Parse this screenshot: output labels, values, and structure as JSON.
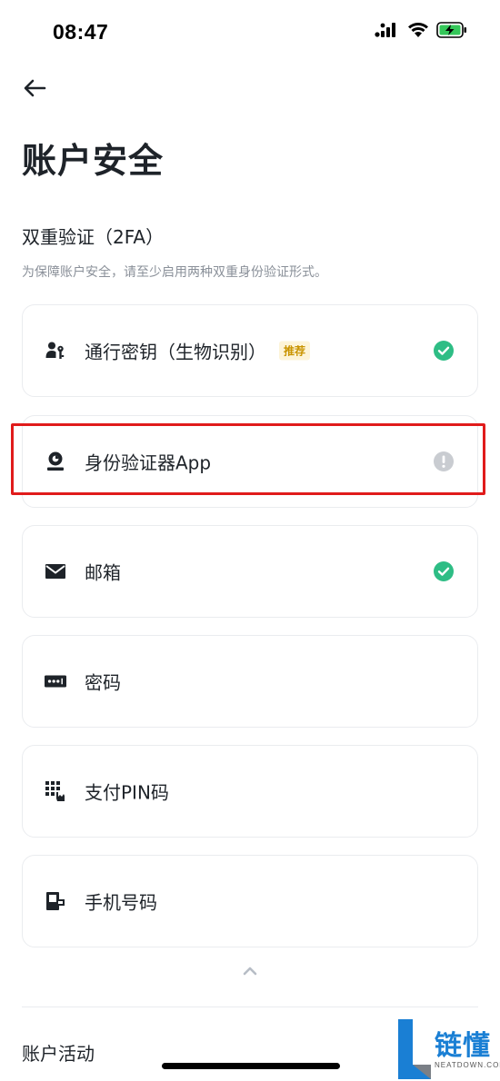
{
  "status_bar": {
    "time": "08:47"
  },
  "header": {
    "title": "账户安全"
  },
  "twofa": {
    "title": "双重验证（2FA）",
    "description": "为保障账户安全，请至少启用两种双重身份验证形式。",
    "items": [
      {
        "label": "通行密钥（生物识别）",
        "badge": "推荐",
        "icon": "passkey-icon",
        "status": "enabled"
      },
      {
        "label": "身份验证器App",
        "icon": "authenticator-icon",
        "status": "warning"
      },
      {
        "label": "邮箱",
        "icon": "email-icon",
        "status": "enabled"
      },
      {
        "label": "密码",
        "icon": "password-icon",
        "status": "none"
      },
      {
        "label": "支付PIN码",
        "icon": "pin-keypad-icon",
        "status": "none"
      },
      {
        "label": "手机号码",
        "icon": "phone-icon",
        "status": "none"
      }
    ]
  },
  "activity": {
    "title": "账户活动"
  },
  "watermark": {
    "text": "链懂",
    "sub": "NEATDOWN.COM"
  },
  "colors": {
    "success": "#2ebd85",
    "warning_gray": "#c9ccd1",
    "highlight": "#e01b1b",
    "badge_bg": "#fdf4d8",
    "badge_text": "#c99400"
  }
}
